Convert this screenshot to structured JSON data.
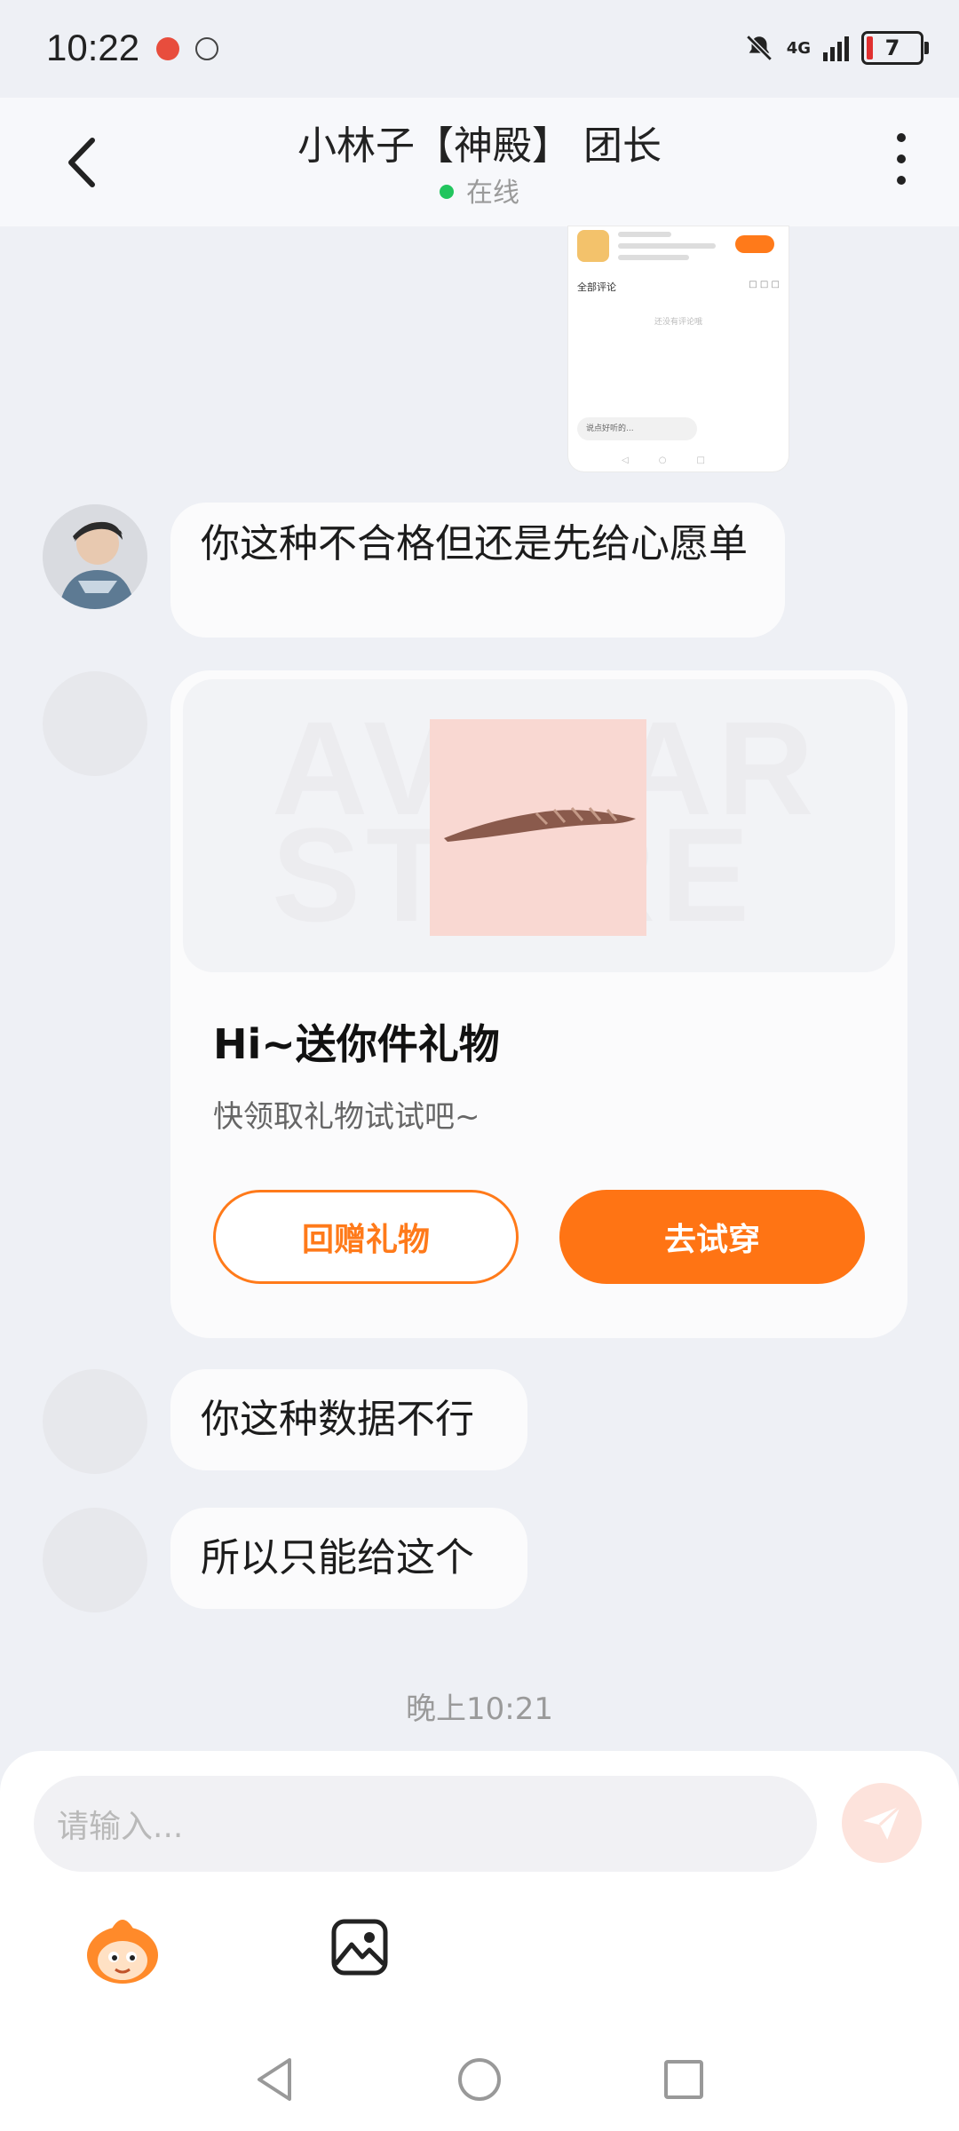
{
  "status_bar": {
    "time": "10:22",
    "network": "4G",
    "battery": "7"
  },
  "header": {
    "title": "小林子【神殿】 团长",
    "presence": "在线"
  },
  "icons": {
    "back": "chevron-left-icon",
    "more": "more-vertical-icon",
    "send": "send-icon",
    "sticker": "mascot-sticker-icon",
    "image": "image-icon"
  },
  "thumbnail": {
    "section_label": "全部评论",
    "input_hint": "说点好听的...",
    "empty_text": "还没有评论哦"
  },
  "messages": [
    {
      "text": "你这种不合格但还是先给心愿单"
    },
    {
      "type": "gift_card",
      "watermark": "AVATAR STORE",
      "title": "Hi~送你件礼物",
      "subtitle": "快领取礼物试试吧~",
      "secondary_button": "回赠礼物",
      "primary_button": "去试穿"
    },
    {
      "text": "你这种数据不行"
    },
    {
      "text": "所以只能给这个"
    }
  ],
  "timestamp": "晚上10:21",
  "composer": {
    "placeholder": "请输入..."
  },
  "colors": {
    "accent": "#ff7414",
    "online": "#22c55e",
    "background": "#eef0f5"
  }
}
